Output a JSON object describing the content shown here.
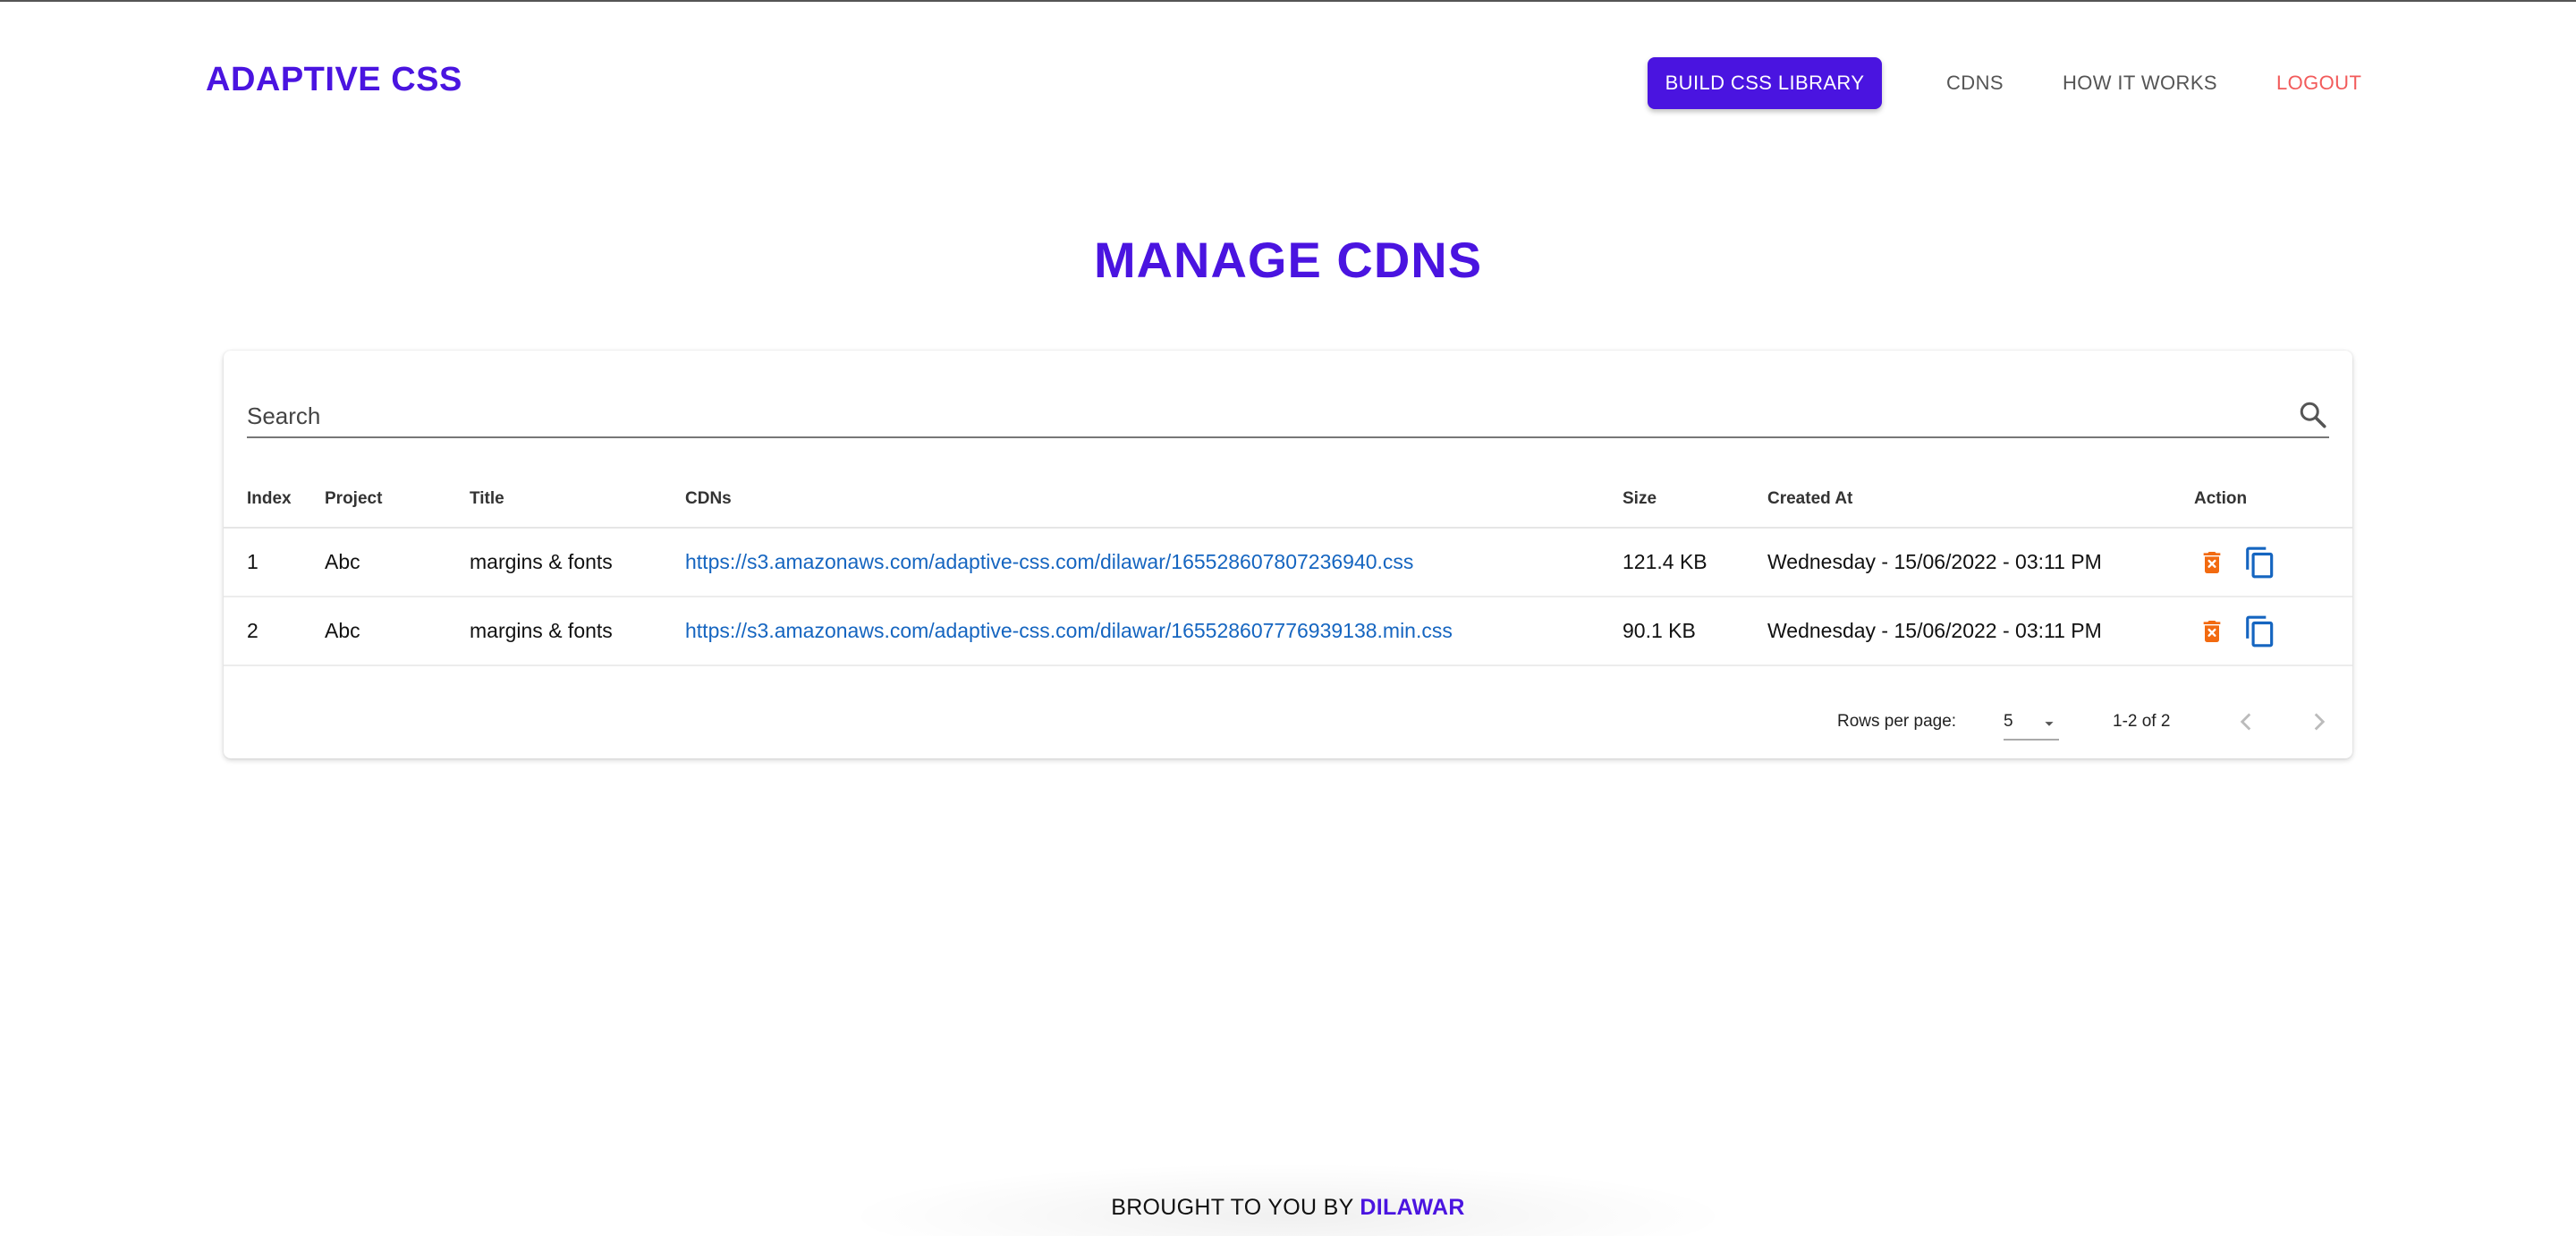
{
  "header": {
    "brand": "ADAPTIVE CSS",
    "build_button": "BUILD CSS LIBRARY",
    "nav": [
      "CDNS",
      "HOW IT WORKS",
      "LOGOUT"
    ]
  },
  "page": {
    "title": "MANAGE CDNS"
  },
  "search": {
    "placeholder": "Search"
  },
  "table": {
    "headers": [
      "Index",
      "Project",
      "Title",
      "CDNs",
      "Size",
      "Created At",
      "Action"
    ],
    "rows": [
      {
        "index": "1",
        "project": "Abc",
        "title": "margins & fonts",
        "cdn": "https://s3.amazonaws.com/adaptive-css.com/dilawar/165528607807236940.css",
        "size": "121.4 KB",
        "created_at": "Wednesday - 15/06/2022 - 03:11 PM"
      },
      {
        "index": "2",
        "project": "Abc",
        "title": "margins & fonts",
        "cdn": "https://s3.amazonaws.com/adaptive-css.com/dilawar/165528607776939138.min.css",
        "size": "90.1 KB",
        "created_at": "Wednesday - 15/06/2022 - 03:11 PM"
      }
    ],
    "action_icons": [
      "delete-icon",
      "copy-icon"
    ]
  },
  "pagination": {
    "rows_per_page_label": "Rows per page:",
    "rows_per_page_value": "5",
    "range": "1-2 of 2"
  },
  "footer": {
    "prefix": "BROUGHT TO YOU BY",
    "author": "DILAWAR"
  },
  "colors": {
    "brand": "#4a14e0",
    "logout": "#f25b5b",
    "link": "#1565c0",
    "delete_icon": "#f26a10",
    "copy_icon": "#1565c0"
  }
}
